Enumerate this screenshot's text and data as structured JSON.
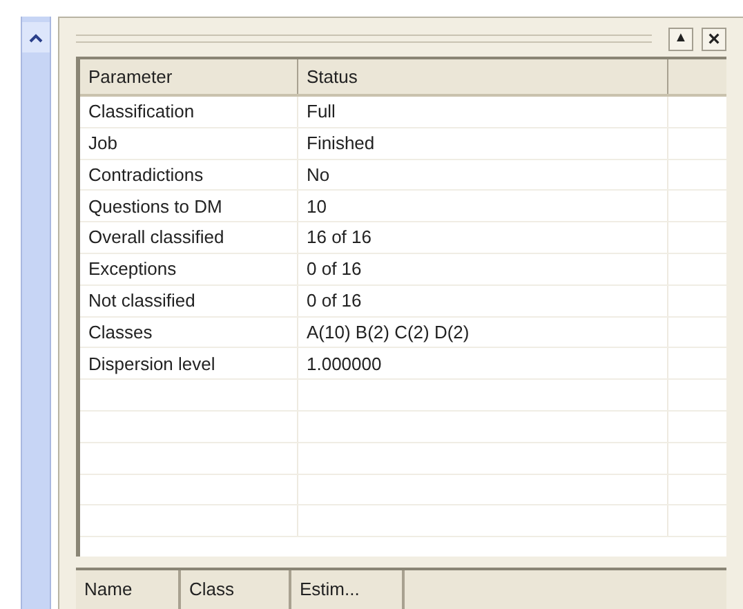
{
  "panel": {
    "buttons": [
      {
        "kind": "up",
        "label": "▲"
      },
      {
        "kind": "close",
        "label": "×"
      }
    ]
  },
  "table": {
    "columns": [
      "Parameter",
      "Status"
    ],
    "rows": [
      {
        "parameter": "Classification",
        "status": "Full"
      },
      {
        "parameter": "Job",
        "status": "Finished"
      },
      {
        "parameter": "Contradictions",
        "status": "No"
      },
      {
        "parameter": "Questions to DM",
        "status": "10"
      },
      {
        "parameter": "Overall classified",
        "status": "16 of 16"
      },
      {
        "parameter": "Exceptions",
        "status": "0 of 16"
      },
      {
        "parameter": "Not classified",
        "status": "0 of 16"
      },
      {
        "parameter": "Classes",
        "status": "A(10) B(2) C(2) D(2)"
      },
      {
        "parameter": "Dispersion level",
        "status": "1.000000"
      }
    ]
  },
  "objects_table": {
    "columns": [
      "Name",
      "Class",
      "Estim..."
    ]
  }
}
